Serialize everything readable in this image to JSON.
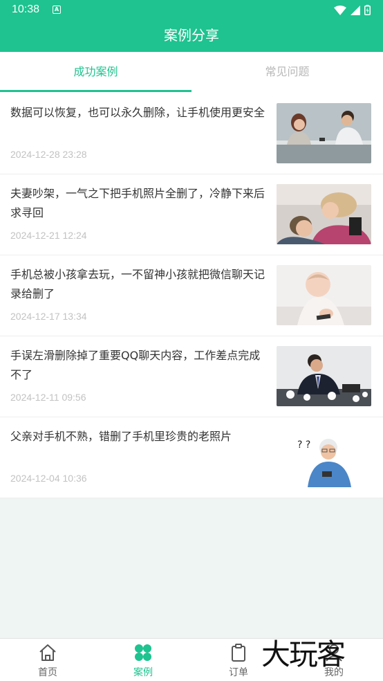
{
  "status_bar": {
    "time": "10:38",
    "notif_letter": "A"
  },
  "header": {
    "title": "案例分享"
  },
  "tabs": [
    {
      "label": "成功案例",
      "active": true
    },
    {
      "label": "常见问题",
      "active": false
    }
  ],
  "cases": [
    {
      "title": "数据可以恢复，也可以永久删除，让手机使用更安全",
      "date": "2024-12-28 23:28"
    },
    {
      "title": "夫妻吵架，一气之下把手机照片全删了，冷静下来后求寻回",
      "date": "2024-12-21 12:24"
    },
    {
      "title": "手机总被小孩拿去玩，一不留神小孩就把微信聊天记录给删了",
      "date": "2024-12-17 13:34"
    },
    {
      "title": "手误左滑删除掉了重要QQ聊天内容，工作差点完成不了",
      "date": "2024-12-11 09:56"
    },
    {
      "title": "父亲对手机不熟，错删了手机里珍贵的老照片",
      "date": "2024-12-04 10:36"
    }
  ],
  "bottom_nav": [
    {
      "label": "首页",
      "icon": "home-icon",
      "active": false
    },
    {
      "label": "案例",
      "icon": "grid-icon",
      "active": true
    },
    {
      "label": "订单",
      "icon": "clipboard-icon",
      "active": false
    },
    {
      "label": "我的",
      "icon": "user-icon",
      "active": false
    }
  ],
  "watermark": "大玩客",
  "colors": {
    "accent": "#1ec38f",
    "date_gray": "#c2c2c2",
    "inactive_tab": "#b8b8b8"
  }
}
